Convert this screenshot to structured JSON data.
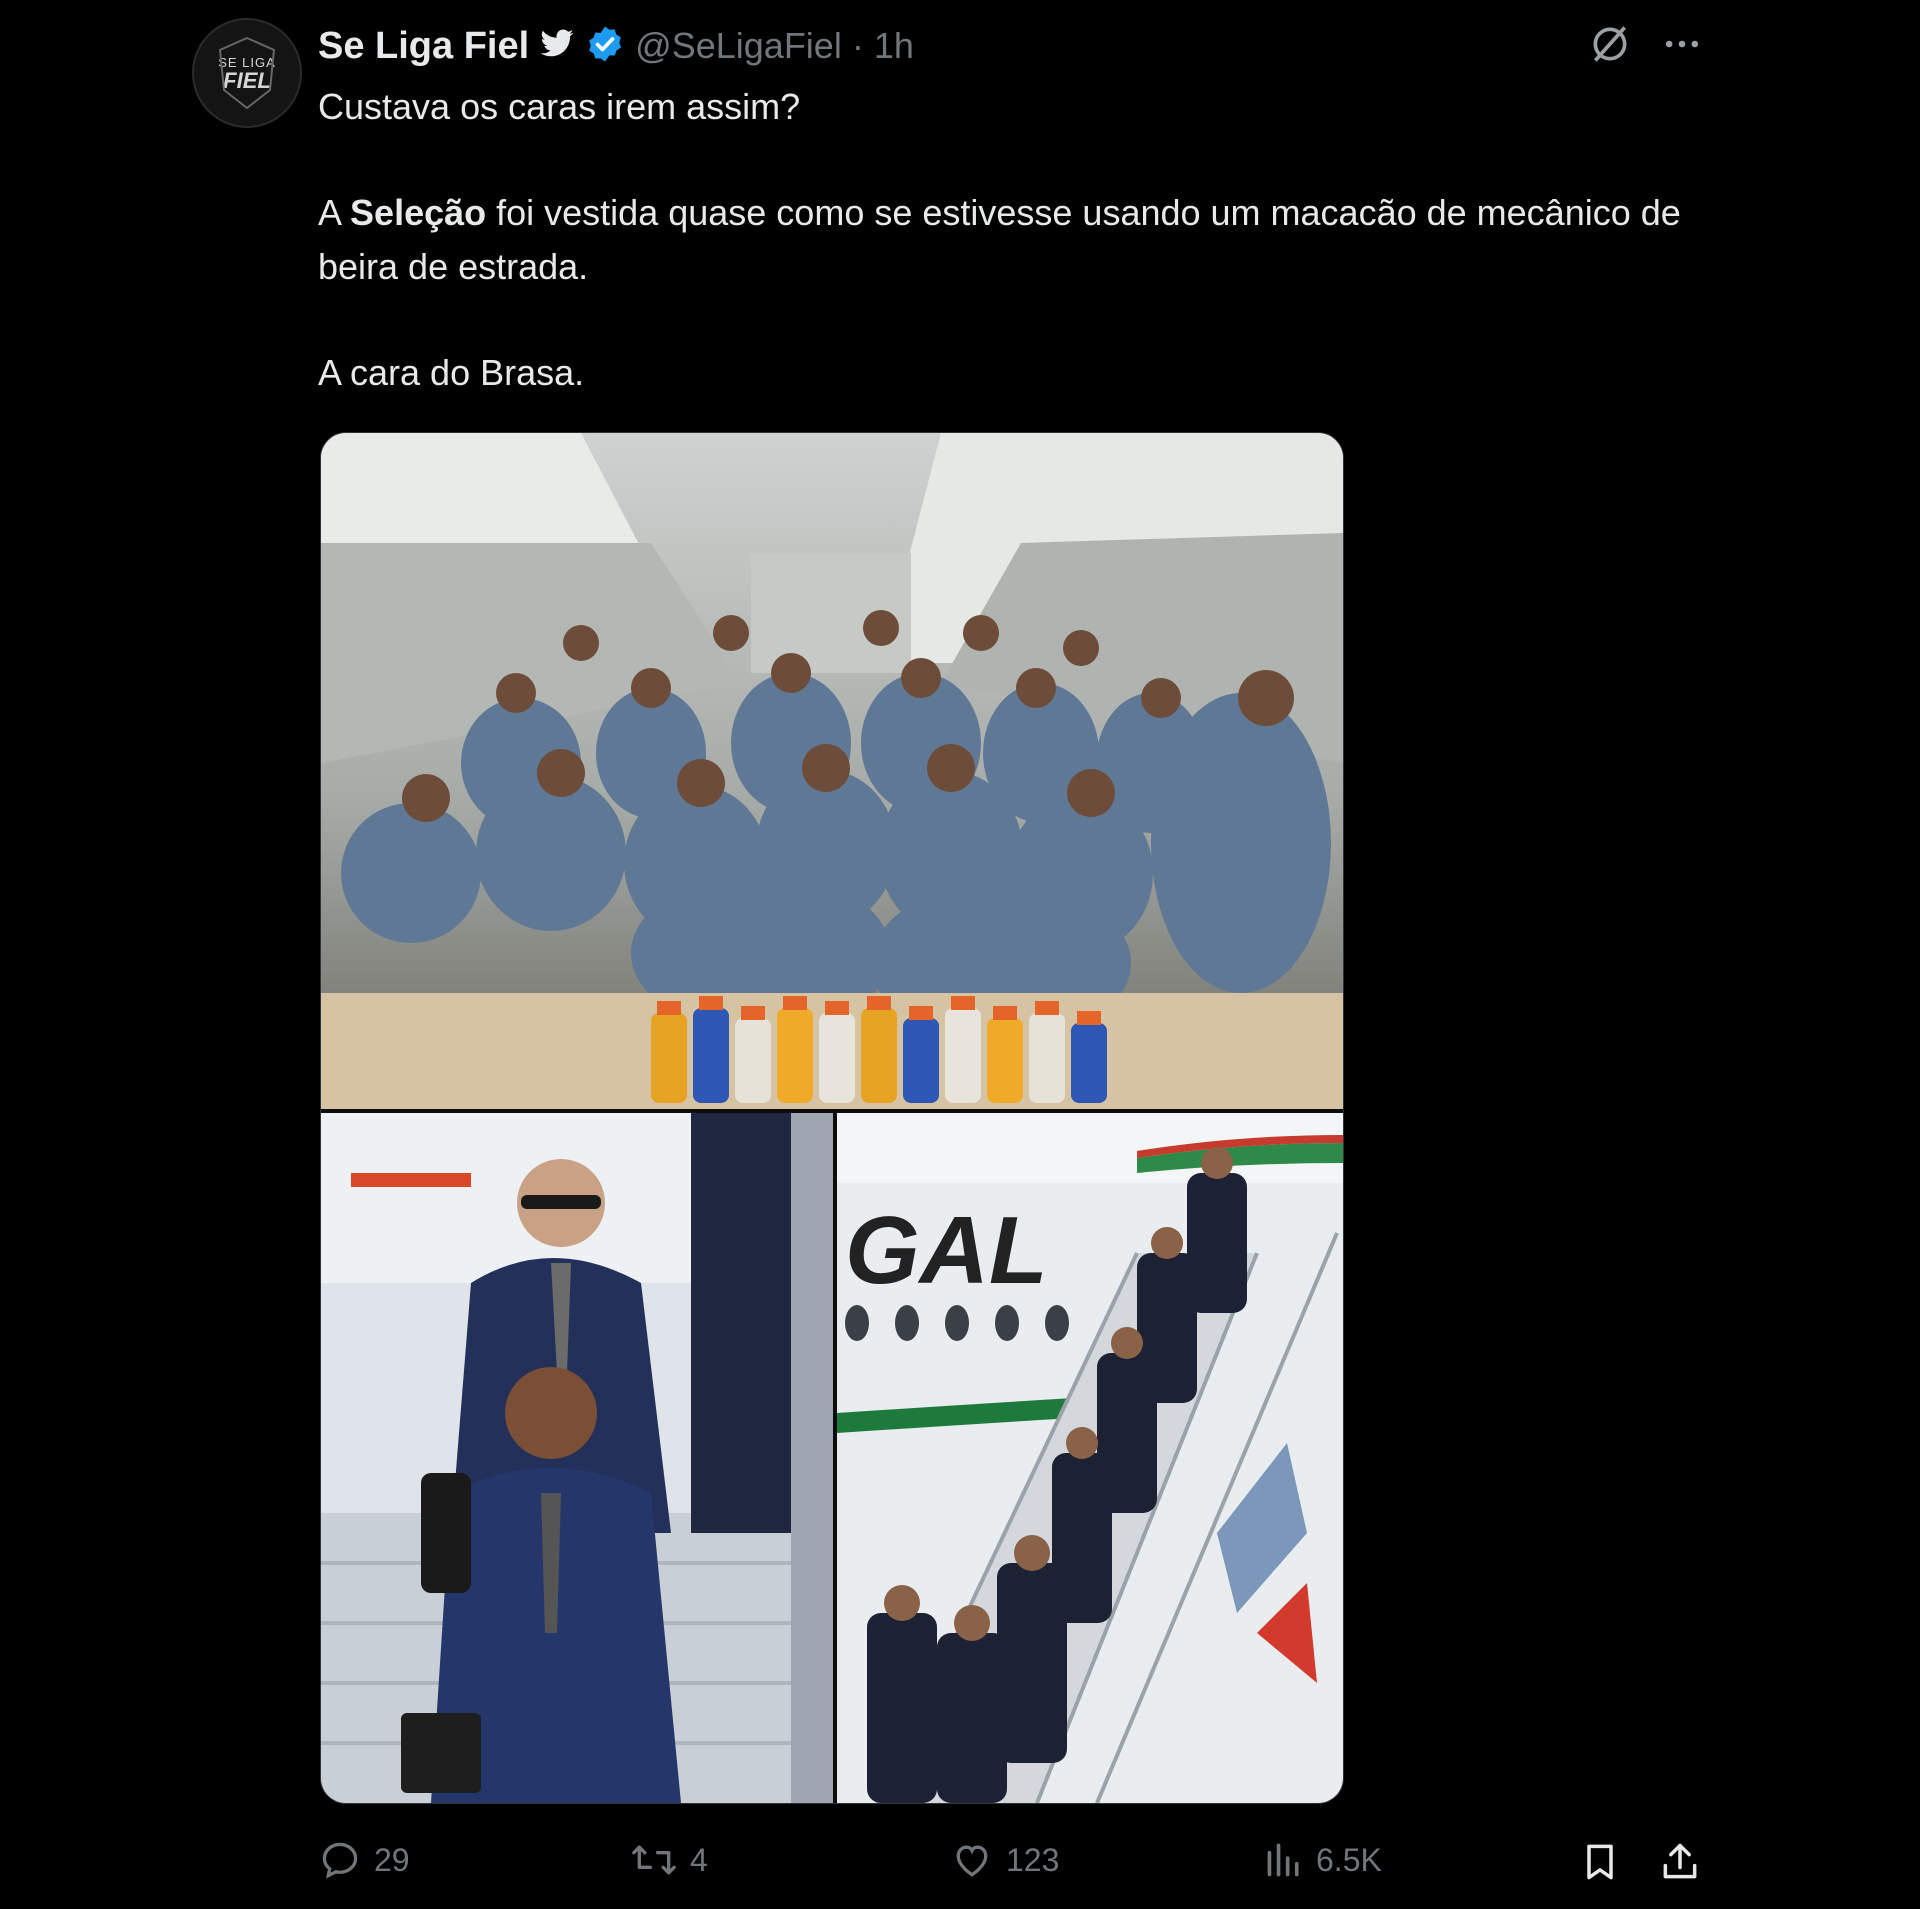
{
  "tweet": {
    "display_name": "Se Liga Fiel",
    "handle": "@SeLigaFiel",
    "separator": "·",
    "time": "1h",
    "avatar_text_top": "SE LIGA",
    "avatar_text_main": "FIEL",
    "line1": "Custava os caras irem assim?",
    "para2_pre": "A ",
    "para2_bold": "Seleção",
    "para2_post": " foi vestida quase como se estivesse usando um macacão de mecânico de beira de estrada.",
    "line3": "A cara do Brasa.",
    "media": {
      "photo2_plane_text": "GAL"
    },
    "stats": {
      "replies": "29",
      "reposts": "4",
      "likes": "123",
      "views": "6.5K"
    }
  },
  "colors": {
    "background": "#000000",
    "text": "#e7e9ea",
    "muted": "#71767b",
    "verified": "#1d9bf0"
  }
}
